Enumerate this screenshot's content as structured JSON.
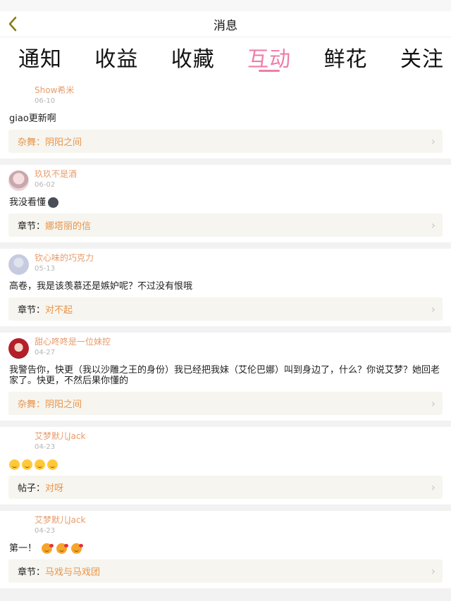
{
  "nav": {
    "title": "消息"
  },
  "tabs": [
    {
      "label": "通知",
      "active": false
    },
    {
      "label": "收益",
      "active": false
    },
    {
      "label": "收藏",
      "active": false
    },
    {
      "label": "互动",
      "active": true
    },
    {
      "label": "鲜花",
      "active": false
    },
    {
      "label": "关注",
      "active": false
    }
  ],
  "colors": {
    "accent": "#ee7ea9",
    "username": "#e89b6a",
    "ref_link": "#e8934a",
    "ref_bg": "#f6f5ef"
  },
  "messages": [
    {
      "user": "Show希米",
      "date": "06-10",
      "text": "giao更新啊",
      "ref_type": "杂舞：",
      "ref_name": "阴阳之间"
    },
    {
      "user": "玖玖不是酒",
      "date": "06-02",
      "text": "我没看懂",
      "ref_type": "章节：",
      "ref_name": "娜塔丽的信"
    },
    {
      "user": "钦心味的巧克力",
      "date": "05-13",
      "text": "高卷，我是该羡慕还是嫉妒呢？不过没有恨哦",
      "ref_type": "章节：",
      "ref_name": "对不起"
    },
    {
      "user": "甜心咚咚是一位妹控",
      "date": "04-27",
      "text": "我警告你，快更（我以沙雕之王的身份）我已经把我妹（艾伦巴娜）叫到身边了，什么？你说艾梦？她回老家了。快更，不然后果你懂的",
      "ref_type": "杂舞：",
      "ref_name": "阴阳之间"
    },
    {
      "user": "艾梦默儿Jack",
      "date": "04-23",
      "text": "",
      "ref_type": "帖子：",
      "ref_name": "对呀"
    },
    {
      "user": "艾梦默儿Jack",
      "date": "04-23",
      "text": "第一！",
      "ref_type": "章节：",
      "ref_name": "马戏与马戏团"
    }
  ]
}
